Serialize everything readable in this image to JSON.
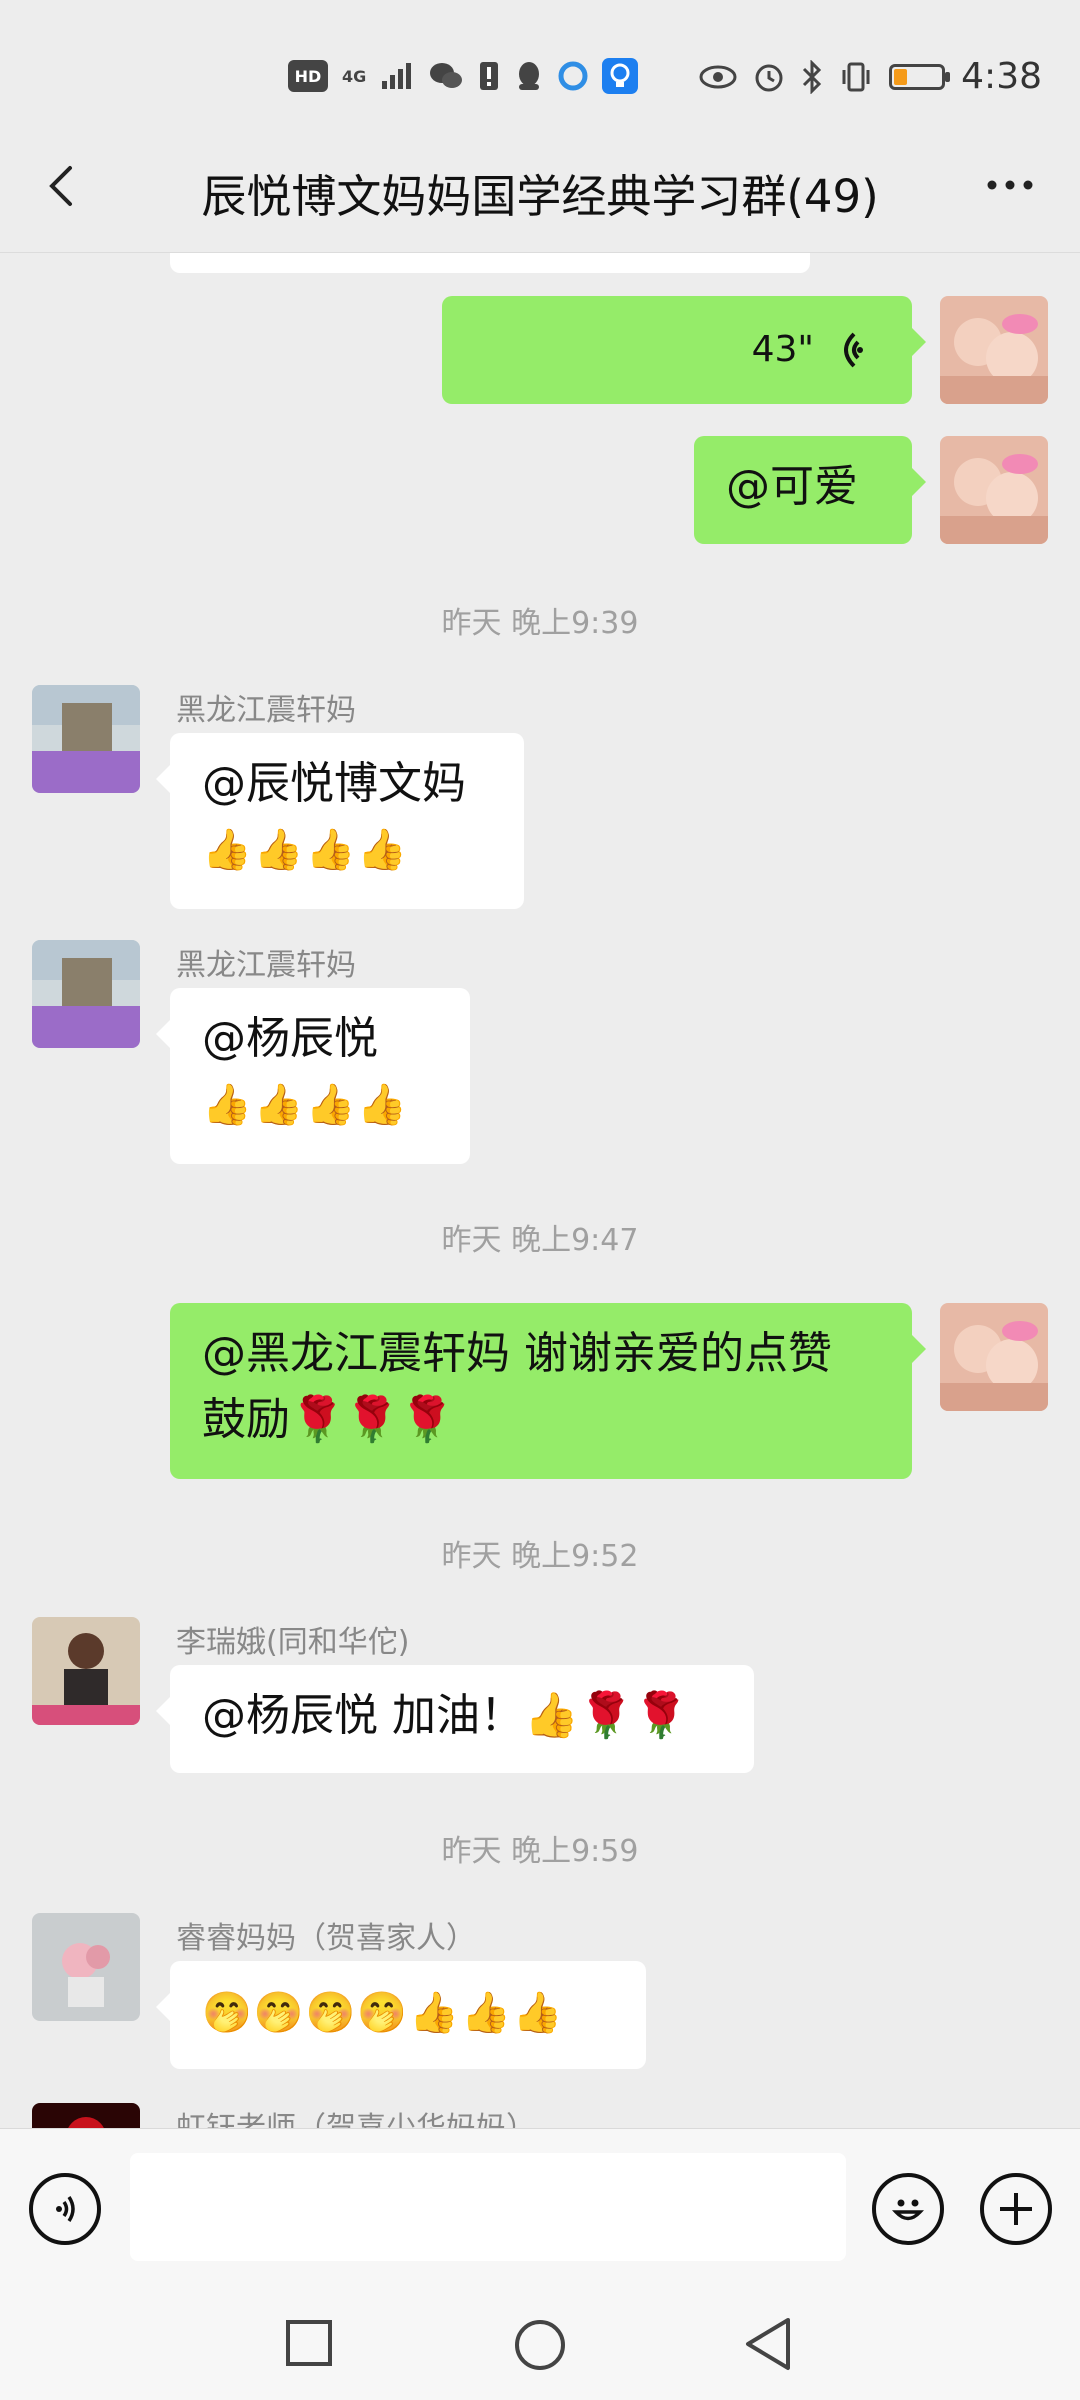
{
  "status_bar": {
    "left_chips": [
      "HD",
      "4G",
      "📶",
      "💬",
      "!",
      "🔔",
      "◐",
      "💡"
    ],
    "time": "4:38",
    "battery_level": 0.25
  },
  "header": {
    "back_label": "<",
    "title": "辰悦博文妈妈国学经典学习群(49)"
  },
  "messages": {
    "voice": {
      "duration": "43\""
    },
    "m_ke_ai": {
      "text": "@可爱"
    },
    "ts1": "昨天 晚上9:39",
    "m1": {
      "sender": "黑龙江震轩妈",
      "line1": "@辰悦博文妈",
      "line2": "👍👍👍👍"
    },
    "m2": {
      "sender": "黑龙江震轩妈",
      "line1": "@杨辰悦",
      "line2": "👍👍👍👍"
    },
    "ts2": "昨天 晚上9:47",
    "m3": {
      "line1": "@黑龙江震轩妈  谢谢亲爱的点赞",
      "line2": "鼓励🌹🌹🌹"
    },
    "ts3": "昨天 晚上9:52",
    "m4": {
      "sender": "李瑞娥(同和华佗)",
      "text": "@杨辰悦  加油！👍🌹🌹"
    },
    "ts4": "昨天 晚上9:59",
    "m5": {
      "sender": "睿睿妈妈（贺喜家人）",
      "text": "🤭🤭🤭🤭👍👍👍"
    },
    "m6": {
      "sender": "虹钰老师（贺喜少华妈妈）"
    }
  },
  "input_bar": {
    "voice_icon": "voice-icon",
    "emoji_icon": "smiley-icon",
    "plus_icon": "plus-icon"
  },
  "colors": {
    "out_bubble": "#95ec69",
    "in_bubble": "#ffffff",
    "background": "#ededed"
  }
}
